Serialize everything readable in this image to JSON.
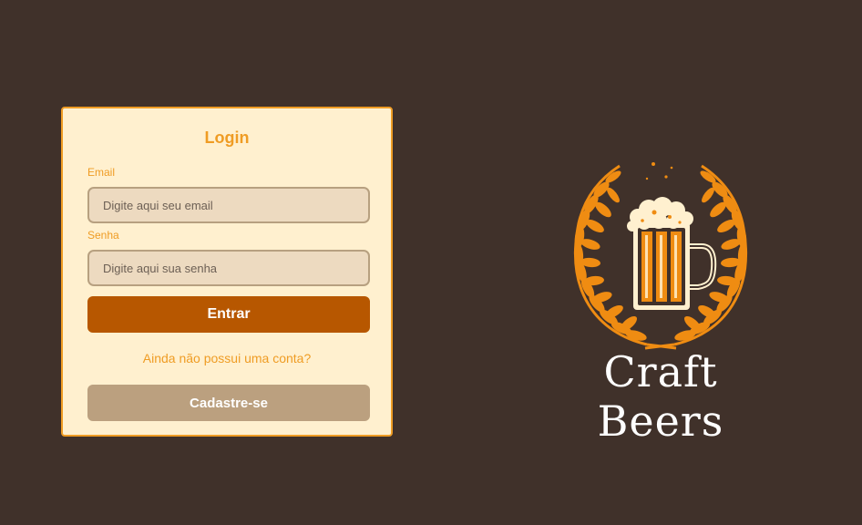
{
  "login": {
    "title": "Login",
    "email_label": "Email",
    "email_placeholder": "Digite aqui seu email",
    "email_value": "",
    "password_label": "Senha",
    "password_placeholder": "Digite aqui sua senha",
    "password_value": "",
    "submit_label": "Entrar",
    "signup_prompt": "Ainda não possui uma conta?",
    "register_label": "Cadastre-se"
  },
  "brand": {
    "name": "Craft Beers",
    "logo_icon": "beer-mug-laurel-icon"
  },
  "colors": {
    "background": "#40312a",
    "card_background": "#fff0cf",
    "accent": "#ef9c24",
    "primary_button": "#b75700",
    "secondary_button": "#bba07f",
    "input_background": "#eddac0"
  }
}
